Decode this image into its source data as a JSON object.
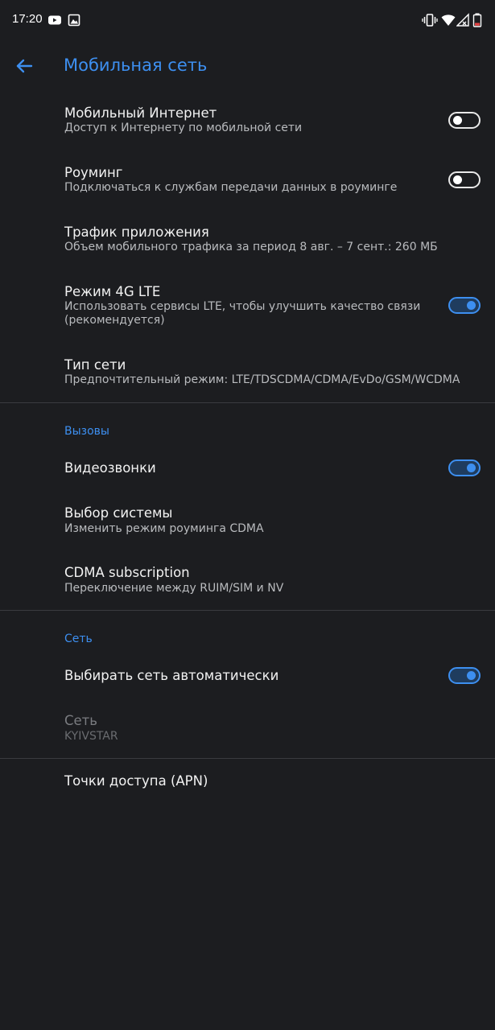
{
  "status_bar": {
    "time": "17:20",
    "icons_left": [
      "youtube-icon",
      "gallery-icon"
    ],
    "icons_right": [
      "vibrate-icon",
      "wifi-icon",
      "signal-icon",
      "battery-low-icon"
    ]
  },
  "app_bar": {
    "title": "Мобильная сеть",
    "back_icon": "arrow-back-icon"
  },
  "colors": {
    "background": "#1c1d20",
    "accent": "#3d8ff0",
    "text_primary": "#f2f2f2",
    "text_secondary": "#b9bbbe"
  },
  "settings": {
    "mobile_data": {
      "title": "Мобильный Интернет",
      "summary": "Доступ к Интернету по мобильной сети",
      "enabled": false
    },
    "roaming": {
      "title": "Роуминг",
      "summary": "Подключаться к службам передачи данных в роуминге",
      "enabled": false
    },
    "app_traffic": {
      "title": "Трафик приложения",
      "summary": "Объем мобильного трафика за период 8 авг. – 7 сент.: 260 МБ"
    },
    "lte_mode": {
      "title": "Режим 4G LTE",
      "summary": "Использовать сервисы LTE, чтобы улучшить качество связи (рекомендуется)",
      "enabled": true
    },
    "network_type": {
      "title": "Тип сети",
      "summary": "Предпочтительный режим: LTE/TDSCDMA/CDMA/EvDo/GSM/WCDMA"
    }
  },
  "calls_section": {
    "header": "Вызовы",
    "video_calls": {
      "title": "Видеозвонки",
      "enabled": true
    },
    "system_select": {
      "title": "Выбор системы",
      "summary": "Изменить режим роуминга CDMA"
    },
    "cdma_subscription": {
      "title": "CDMA subscription",
      "summary": "Переключение между RUIM/SIM и NV"
    }
  },
  "network_section": {
    "header": "Сеть",
    "auto_select": {
      "title": "Выбирать сеть автоматически",
      "enabled": true
    },
    "network": {
      "title": "Сеть",
      "summary": "KYIVSTAR"
    },
    "apn": {
      "title": "Точки доступа (APN)"
    }
  }
}
